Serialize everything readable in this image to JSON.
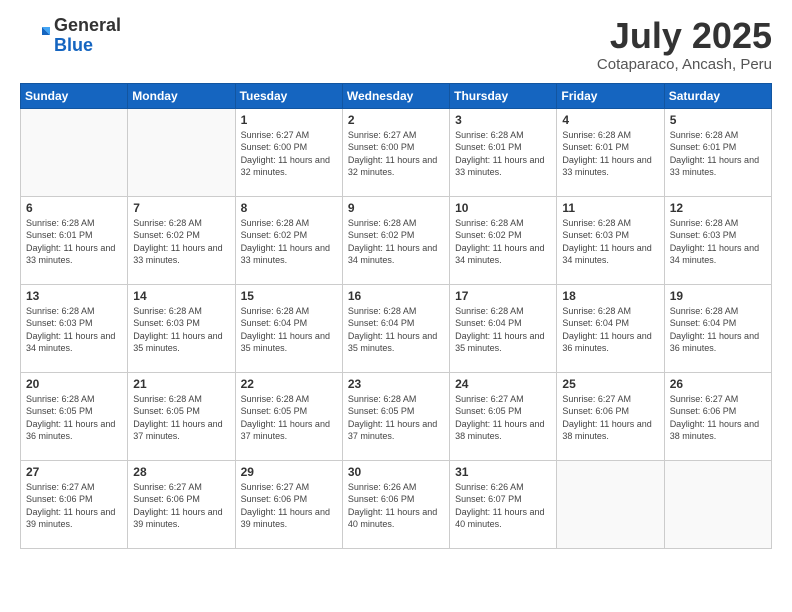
{
  "header": {
    "logo_general": "General",
    "logo_blue": "Blue",
    "month": "July 2025",
    "location": "Cotaparaco, Ancash, Peru"
  },
  "weekdays": [
    "Sunday",
    "Monday",
    "Tuesday",
    "Wednesday",
    "Thursday",
    "Friday",
    "Saturday"
  ],
  "weeks": [
    [
      {
        "day": "",
        "info": ""
      },
      {
        "day": "",
        "info": ""
      },
      {
        "day": "1",
        "info": "Sunrise: 6:27 AM\nSunset: 6:00 PM\nDaylight: 11 hours and 32 minutes."
      },
      {
        "day": "2",
        "info": "Sunrise: 6:27 AM\nSunset: 6:00 PM\nDaylight: 11 hours and 32 minutes."
      },
      {
        "day": "3",
        "info": "Sunrise: 6:28 AM\nSunset: 6:01 PM\nDaylight: 11 hours and 33 minutes."
      },
      {
        "day": "4",
        "info": "Sunrise: 6:28 AM\nSunset: 6:01 PM\nDaylight: 11 hours and 33 minutes."
      },
      {
        "day": "5",
        "info": "Sunrise: 6:28 AM\nSunset: 6:01 PM\nDaylight: 11 hours and 33 minutes."
      }
    ],
    [
      {
        "day": "6",
        "info": "Sunrise: 6:28 AM\nSunset: 6:01 PM\nDaylight: 11 hours and 33 minutes."
      },
      {
        "day": "7",
        "info": "Sunrise: 6:28 AM\nSunset: 6:02 PM\nDaylight: 11 hours and 33 minutes."
      },
      {
        "day": "8",
        "info": "Sunrise: 6:28 AM\nSunset: 6:02 PM\nDaylight: 11 hours and 33 minutes."
      },
      {
        "day": "9",
        "info": "Sunrise: 6:28 AM\nSunset: 6:02 PM\nDaylight: 11 hours and 34 minutes."
      },
      {
        "day": "10",
        "info": "Sunrise: 6:28 AM\nSunset: 6:02 PM\nDaylight: 11 hours and 34 minutes."
      },
      {
        "day": "11",
        "info": "Sunrise: 6:28 AM\nSunset: 6:03 PM\nDaylight: 11 hours and 34 minutes."
      },
      {
        "day": "12",
        "info": "Sunrise: 6:28 AM\nSunset: 6:03 PM\nDaylight: 11 hours and 34 minutes."
      }
    ],
    [
      {
        "day": "13",
        "info": "Sunrise: 6:28 AM\nSunset: 6:03 PM\nDaylight: 11 hours and 34 minutes."
      },
      {
        "day": "14",
        "info": "Sunrise: 6:28 AM\nSunset: 6:03 PM\nDaylight: 11 hours and 35 minutes."
      },
      {
        "day": "15",
        "info": "Sunrise: 6:28 AM\nSunset: 6:04 PM\nDaylight: 11 hours and 35 minutes."
      },
      {
        "day": "16",
        "info": "Sunrise: 6:28 AM\nSunset: 6:04 PM\nDaylight: 11 hours and 35 minutes."
      },
      {
        "day": "17",
        "info": "Sunrise: 6:28 AM\nSunset: 6:04 PM\nDaylight: 11 hours and 35 minutes."
      },
      {
        "day": "18",
        "info": "Sunrise: 6:28 AM\nSunset: 6:04 PM\nDaylight: 11 hours and 36 minutes."
      },
      {
        "day": "19",
        "info": "Sunrise: 6:28 AM\nSunset: 6:04 PM\nDaylight: 11 hours and 36 minutes."
      }
    ],
    [
      {
        "day": "20",
        "info": "Sunrise: 6:28 AM\nSunset: 6:05 PM\nDaylight: 11 hours and 36 minutes."
      },
      {
        "day": "21",
        "info": "Sunrise: 6:28 AM\nSunset: 6:05 PM\nDaylight: 11 hours and 37 minutes."
      },
      {
        "day": "22",
        "info": "Sunrise: 6:28 AM\nSunset: 6:05 PM\nDaylight: 11 hours and 37 minutes."
      },
      {
        "day": "23",
        "info": "Sunrise: 6:28 AM\nSunset: 6:05 PM\nDaylight: 11 hours and 37 minutes."
      },
      {
        "day": "24",
        "info": "Sunrise: 6:27 AM\nSunset: 6:05 PM\nDaylight: 11 hours and 38 minutes."
      },
      {
        "day": "25",
        "info": "Sunrise: 6:27 AM\nSunset: 6:06 PM\nDaylight: 11 hours and 38 minutes."
      },
      {
        "day": "26",
        "info": "Sunrise: 6:27 AM\nSunset: 6:06 PM\nDaylight: 11 hours and 38 minutes."
      }
    ],
    [
      {
        "day": "27",
        "info": "Sunrise: 6:27 AM\nSunset: 6:06 PM\nDaylight: 11 hours and 39 minutes."
      },
      {
        "day": "28",
        "info": "Sunrise: 6:27 AM\nSunset: 6:06 PM\nDaylight: 11 hours and 39 minutes."
      },
      {
        "day": "29",
        "info": "Sunrise: 6:27 AM\nSunset: 6:06 PM\nDaylight: 11 hours and 39 minutes."
      },
      {
        "day": "30",
        "info": "Sunrise: 6:26 AM\nSunset: 6:06 PM\nDaylight: 11 hours and 40 minutes."
      },
      {
        "day": "31",
        "info": "Sunrise: 6:26 AM\nSunset: 6:07 PM\nDaylight: 11 hours and 40 minutes."
      },
      {
        "day": "",
        "info": ""
      },
      {
        "day": "",
        "info": ""
      }
    ]
  ]
}
